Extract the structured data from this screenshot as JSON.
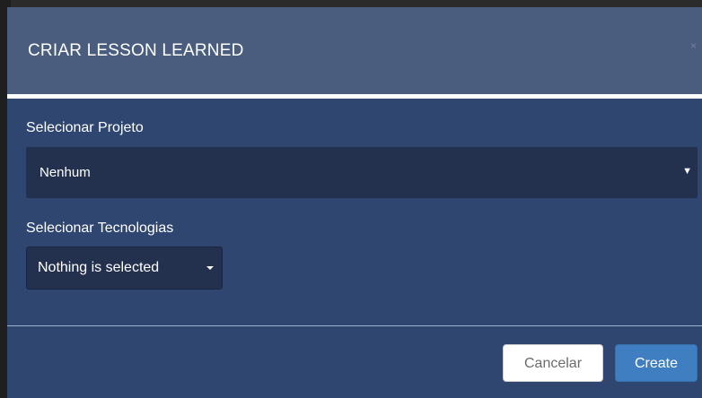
{
  "modal": {
    "title": "CRIAR LESSON LEARNED",
    "close_glyph": "×"
  },
  "form": {
    "project": {
      "label": "Selecionar Projeto",
      "selected": "Nenhum",
      "caret_glyph": "▼"
    },
    "technologies": {
      "label": "Selecionar Tecnologias",
      "selected": "Nothing is selected"
    }
  },
  "footer": {
    "cancel_label": "Cancelar",
    "create_label": "Create"
  },
  "colors": {
    "header_bg": "#4a5d7e",
    "body_bg": "#2f4670",
    "select_bg": "#23314f",
    "primary": "#3f7fc1"
  },
  "icons": {
    "close": "close-icon",
    "project_caret": "chevron-down-icon",
    "tech_caret": "caret-down-icon"
  }
}
